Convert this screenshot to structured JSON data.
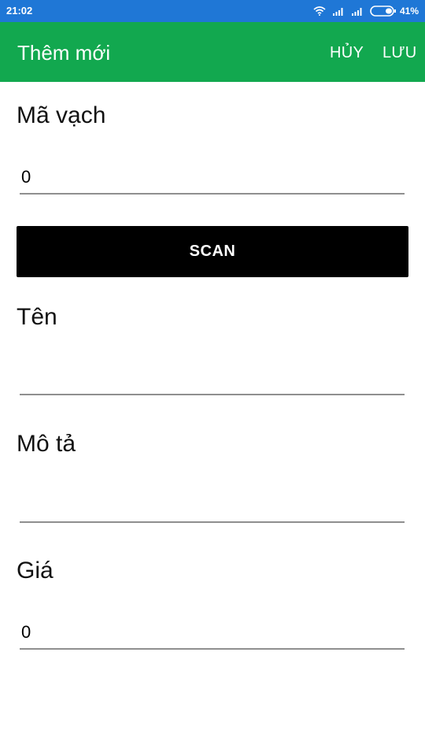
{
  "status_bar": {
    "time": "21:02",
    "battery_percent": "41%",
    "icons": [
      "wifi-icon",
      "signal-icon",
      "signal-icon",
      "battery-icon"
    ]
  },
  "app_bar": {
    "title": "Thêm mới",
    "cancel_label": "HỦY",
    "save_label": "LƯU",
    "background_color": "#12a84f"
  },
  "form": {
    "barcode": {
      "label": "Mã vạch",
      "value": "0"
    },
    "scan_button_label": "SCAN",
    "name": {
      "label": "Tên",
      "value": ""
    },
    "description": {
      "label": "Mô tả",
      "value": ""
    },
    "price": {
      "label": "Giá",
      "value": "0"
    }
  },
  "colors": {
    "status_bar": "#1f77d6",
    "app_bar": "#12a84f",
    "scan_button": "#000000"
  }
}
